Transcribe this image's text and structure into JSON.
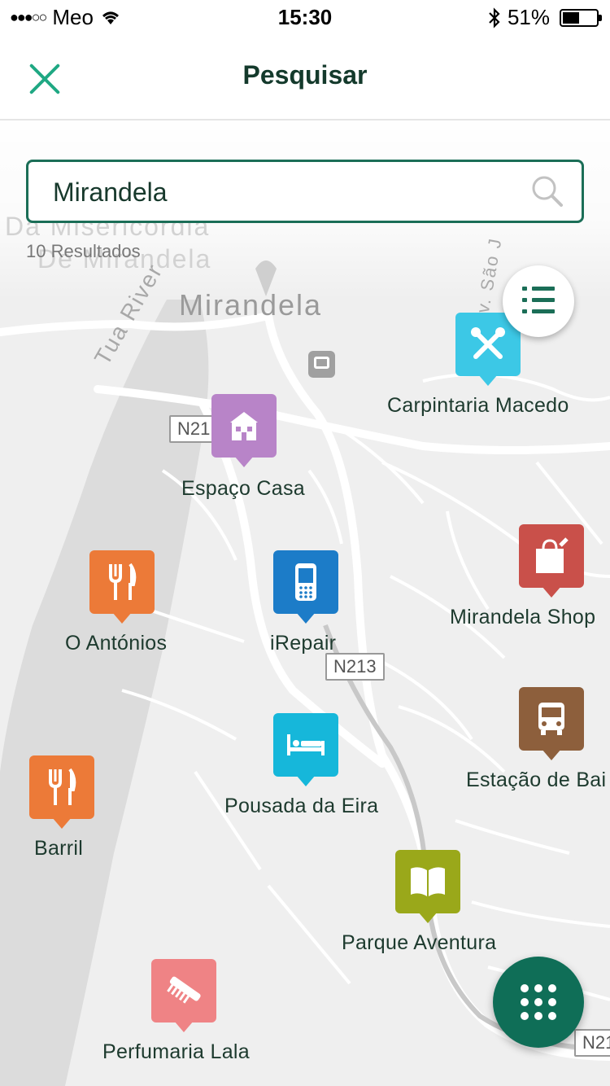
{
  "status_bar": {
    "carrier": "Meo",
    "time": "15:30",
    "battery_percent": "51%",
    "battery_level": 0.51
  },
  "header": {
    "title": "Pesquisar"
  },
  "search": {
    "value": "Mirandela",
    "results": "10 Resultados"
  },
  "map": {
    "labels": {
      "city": "Mirandela",
      "river": "Tua River",
      "faded_top_1": "Da Misericórdia",
      "faded_top_2": "De Mirandela",
      "street": "Av. São J"
    },
    "road_signs": [
      "N21",
      "N213",
      "N21"
    ]
  },
  "places": [
    {
      "name": "Carpintaria Macedo",
      "icon": "tools-icon",
      "color": "#3cc8e6"
    },
    {
      "name": "Espaço Casa",
      "icon": "house-icon",
      "color": "#b884c8"
    },
    {
      "name": "O Antónios",
      "icon": "restaurant-icon",
      "color": "#ec7a38"
    },
    {
      "name": "iRepair",
      "icon": "phone-icon",
      "color": "#1c7cc8"
    },
    {
      "name": "Mirandela Shop",
      "icon": "shopping-bag-icon",
      "color": "#c9504a"
    },
    {
      "name": "Pousada da Eira",
      "icon": "bed-icon",
      "color": "#16b7da"
    },
    {
      "name": "Estação de Bai",
      "icon": "bus-icon",
      "color": "#8d5f3c"
    },
    {
      "name": "Barril",
      "icon": "restaurant-icon",
      "color": "#ec7a38"
    },
    {
      "name": "Parque Aventura",
      "icon": "book-icon",
      "color": "#9aa81a"
    },
    {
      "name": "Perfumaria Lala",
      "icon": "comb-icon",
      "color": "#ef8385"
    }
  ],
  "colors": {
    "accent": "#1b6e57",
    "close": "#1fa883"
  }
}
